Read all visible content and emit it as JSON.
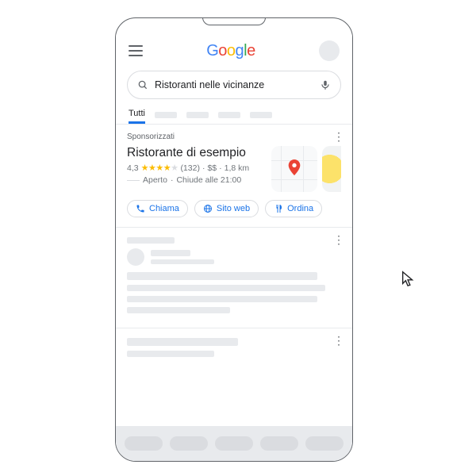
{
  "header": {
    "logo_text": "Google"
  },
  "search": {
    "query": "Ristoranti nelle vicinanze"
  },
  "tabs": {
    "active": "Tutti"
  },
  "ad_card": {
    "sponsored_label": "Sponsorizzati",
    "business_name": "Ristorante di esempio",
    "rating_value": "4,3",
    "review_count": "(132)",
    "price_level": "$$",
    "distance": "1,8 km",
    "open_status": "Aperto",
    "closes_text": "Chiude alle 21:00",
    "actions": {
      "call": "Chiama",
      "website": "Sito web",
      "order": "Ordina"
    }
  }
}
